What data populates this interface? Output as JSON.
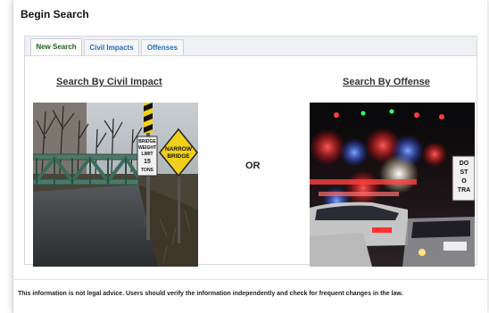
{
  "page": {
    "heading": "Begin Search"
  },
  "tabs": [
    {
      "label": "New Search",
      "active": true
    },
    {
      "label": "Civil Impacts",
      "active": false
    },
    {
      "label": "Offenses",
      "active": false
    }
  ],
  "options": {
    "civil_impact": {
      "title": "Search By Civil Impact",
      "image": "bridge-road-photo"
    },
    "separator": "OR",
    "offense": {
      "title": "Search By Offense",
      "image": "police-lights-photo"
    }
  },
  "signs": {
    "narrow_bridge": [
      "NARROW",
      "BRIDGE"
    ],
    "weight_limit": [
      "BRIDGE",
      "WEIGHT",
      "LIMIT",
      "15",
      "TONS"
    ],
    "road_sign": [
      "DO",
      "ST",
      "O",
      "TRA"
    ]
  },
  "footer": {
    "disclaimer": "This information is not legal advice. Users should verify the information independently and check for frequent changes in the law."
  },
  "colors": {
    "active_tab_text": "#245c1f",
    "inactive_tab_text": "#2a6db5"
  }
}
